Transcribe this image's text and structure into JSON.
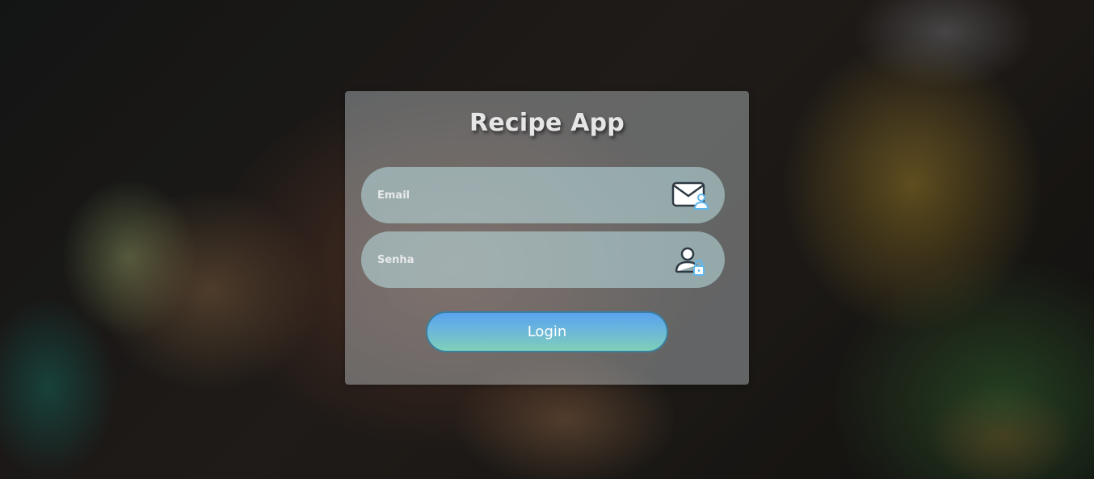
{
  "app": {
    "title": "Recipe App"
  },
  "form": {
    "email": {
      "placeholder": "Email",
      "value": "",
      "icon": "mail-user-icon"
    },
    "senha": {
      "placeholder": "Senha",
      "value": "",
      "icon": "user-lock-icon"
    },
    "login_label": "Login"
  },
  "colors": {
    "button_gradient_top": "#5aa3f0",
    "button_gradient_bottom": "#7fd0b8",
    "button_border": "#3a7fa0",
    "icon_accent": "#5fb8f0",
    "icon_dark": "#2f3a44"
  }
}
